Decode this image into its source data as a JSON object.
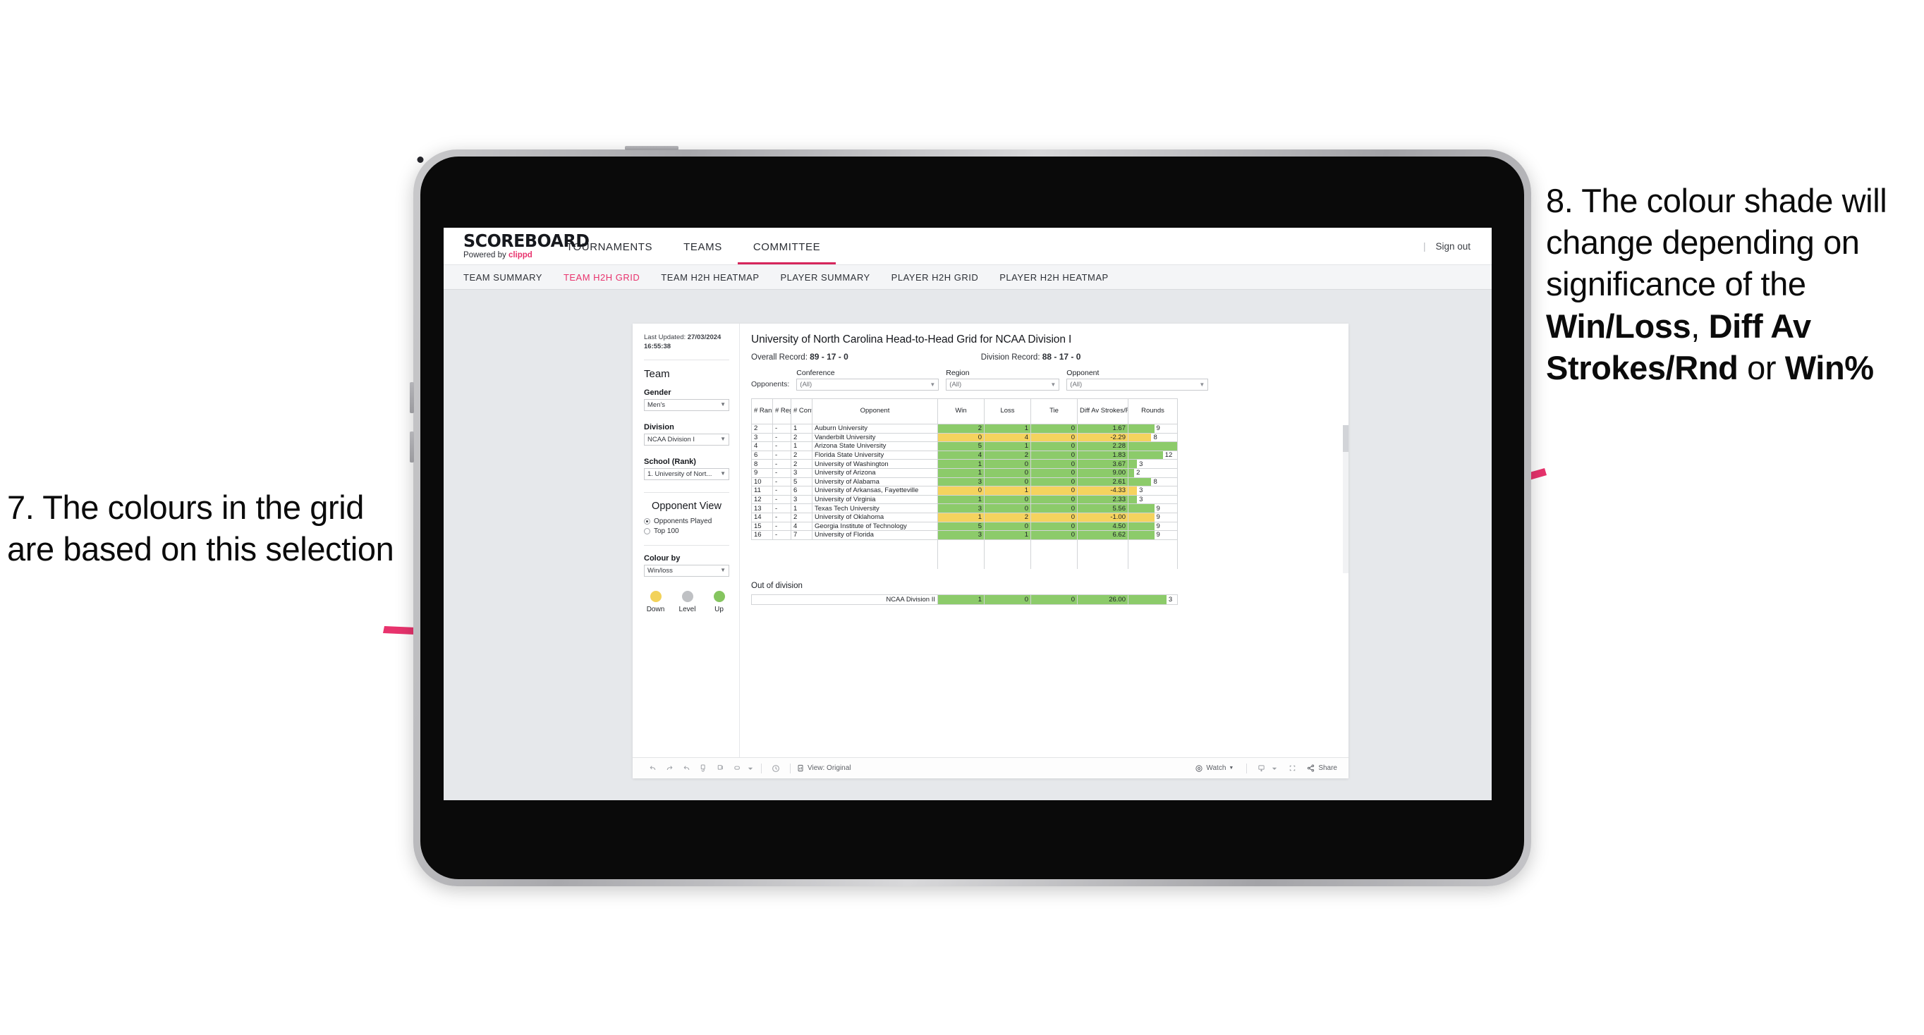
{
  "annotations": {
    "left": {
      "id": "annot-7",
      "text": "7. The colours in the grid are based on this selection"
    },
    "right": {
      "id": "annot-8",
      "prefix": "8. The colour shade will change depending on significance of the ",
      "bold1": "Win/Loss",
      "mid1": ", ",
      "bold2": "Diff Av Strokes/Rnd",
      "mid2": " or ",
      "bold3": "Win%"
    },
    "arrow_color": "#E8336D"
  },
  "topnav": {
    "logo": "SCOREBOARD",
    "logo_sub_prefix": "Powered by ",
    "logo_sub_brand": "clippd",
    "items": [
      {
        "label": "TOURNAMENTS",
        "active": false
      },
      {
        "label": "TEAMS",
        "active": false
      },
      {
        "label": "COMMITTEE",
        "active": true
      }
    ],
    "divider": "|",
    "signout": "Sign out"
  },
  "subnav": {
    "items": [
      {
        "label": "TEAM SUMMARY",
        "active": false
      },
      {
        "label": "TEAM H2H GRID",
        "active": true
      },
      {
        "label": "TEAM H2H HEATMAP",
        "active": false
      },
      {
        "label": "PLAYER SUMMARY",
        "active": false
      },
      {
        "label": "PLAYER H2H GRID",
        "active": false
      },
      {
        "label": "PLAYER H2H HEATMAP",
        "active": false
      }
    ]
  },
  "sidebar": {
    "last_updated_label": "Last Updated: ",
    "last_updated_value": "27/03/2024 16:55:38",
    "team_heading": "Team",
    "gender_label": "Gender",
    "gender_value": "Men's",
    "division_label": "Division",
    "division_value": "NCAA Division I",
    "school_label": "School (Rank)",
    "school_value": "1. University of Nort...",
    "opponent_view_heading": "Opponent View",
    "opponent_view_options": [
      {
        "label": "Opponents Played",
        "selected": true
      },
      {
        "label": "Top 100",
        "selected": false
      }
    ],
    "colour_by_label": "Colour by",
    "colour_by_value": "Win/loss",
    "legend": [
      {
        "label": "Down",
        "color": "#F2D25A"
      },
      {
        "label": "Level",
        "color": "#BFC1C4"
      },
      {
        "label": "Up",
        "color": "#85C55F"
      }
    ]
  },
  "main": {
    "title": "University of North Carolina Head-to-Head Grid for NCAA Division I",
    "overall_record_label": "Overall Record: ",
    "overall_record_value": "89 - 17 - 0",
    "division_record_label": "Division Record: ",
    "division_record_value": "88 - 17 - 0",
    "opponents_word": "Opponents:",
    "filters": [
      {
        "label": "Conference",
        "value": "(All)"
      },
      {
        "label": "Region",
        "value": "(All)"
      },
      {
        "label": "Opponent",
        "value": "(All)"
      }
    ],
    "out_of_division_label": "Out of division",
    "out_of_division_row": {
      "name": "NCAA Division II",
      "win": "1",
      "loss": "0",
      "tie": "0",
      "diff": "26.00",
      "rounds": "3",
      "color": "#8CCB6A"
    }
  },
  "chart_data": {
    "type": "table",
    "title": "University of North Carolina Head-to-Head Grid for NCAA Division I",
    "columns": [
      "# Rank",
      "# Reg",
      "# Conf",
      "Opponent",
      "Win",
      "Loss",
      "Tie",
      "Diff Av Strokes/Rnd",
      "Rounds"
    ],
    "rounds_max": 17,
    "colors": {
      "up": "#8CCB6A",
      "down": "#F5D35E"
    },
    "rows": [
      {
        "rank": "2",
        "reg": "-",
        "conf": "1",
        "opponent": "Auburn University",
        "win": "2",
        "loss": "1",
        "tie": "0",
        "diff": "1.67",
        "rounds": "9",
        "state": "up"
      },
      {
        "rank": "3",
        "reg": "-",
        "conf": "2",
        "opponent": "Vanderbilt University",
        "win": "0",
        "loss": "4",
        "tie": "0",
        "diff": "-2.29",
        "rounds": "8",
        "state": "down"
      },
      {
        "rank": "4",
        "reg": "-",
        "conf": "1",
        "opponent": "Arizona State University",
        "win": "5",
        "loss": "1",
        "tie": "0",
        "diff": "2.28",
        "rounds": "17",
        "state": "up"
      },
      {
        "rank": "6",
        "reg": "-",
        "conf": "2",
        "opponent": "Florida State University",
        "win": "4",
        "loss": "2",
        "tie": "0",
        "diff": "1.83",
        "rounds": "12",
        "state": "up"
      },
      {
        "rank": "8",
        "reg": "-",
        "conf": "2",
        "opponent": "University of Washington",
        "win": "1",
        "loss": "0",
        "tie": "0",
        "diff": "3.67",
        "rounds": "3",
        "state": "up"
      },
      {
        "rank": "9",
        "reg": "-",
        "conf": "3",
        "opponent": "University of Arizona",
        "win": "1",
        "loss": "0",
        "tie": "0",
        "diff": "9.00",
        "rounds": "2",
        "state": "up"
      },
      {
        "rank": "10",
        "reg": "-",
        "conf": "5",
        "opponent": "University of Alabama",
        "win": "3",
        "loss": "0",
        "tie": "0",
        "diff": "2.61",
        "rounds": "8",
        "state": "up"
      },
      {
        "rank": "11",
        "reg": "-",
        "conf": "6",
        "opponent": "University of Arkansas, Fayetteville",
        "win": "0",
        "loss": "1",
        "tie": "0",
        "diff": "-4.33",
        "rounds": "3",
        "state": "down"
      },
      {
        "rank": "12",
        "reg": "-",
        "conf": "3",
        "opponent": "University of Virginia",
        "win": "1",
        "loss": "0",
        "tie": "0",
        "diff": "2.33",
        "rounds": "3",
        "state": "up"
      },
      {
        "rank": "13",
        "reg": "-",
        "conf": "1",
        "opponent": "Texas Tech University",
        "win": "3",
        "loss": "0",
        "tie": "0",
        "diff": "5.56",
        "rounds": "9",
        "state": "up"
      },
      {
        "rank": "14",
        "reg": "-",
        "conf": "2",
        "opponent": "University of Oklahoma",
        "win": "1",
        "loss": "2",
        "tie": "0",
        "diff": "-1.00",
        "rounds": "9",
        "state": "down"
      },
      {
        "rank": "15",
        "reg": "-",
        "conf": "4",
        "opponent": "Georgia Institute of Technology",
        "win": "5",
        "loss": "0",
        "tie": "0",
        "diff": "4.50",
        "rounds": "9",
        "state": "up"
      },
      {
        "rank": "16",
        "reg": "-",
        "conf": "7",
        "opponent": "University of Florida",
        "win": "3",
        "loss": "1",
        "tie": "0",
        "diff": "6.62",
        "rounds": "9",
        "state": "up"
      }
    ]
  },
  "toolbar": {
    "icons": [
      "undo-icon",
      "redo-icon",
      "revert-icon",
      "refresh-icon",
      "pause-icon",
      "swap-icon",
      "chevron-down-icon",
      "clock-history-icon",
      "view-icon"
    ],
    "view_label": "View: Original",
    "watch_label": "Watch",
    "share_label": "Share",
    "device-icon": "device-icon",
    "fullscreen-icon": "fullscreen-icon"
  }
}
